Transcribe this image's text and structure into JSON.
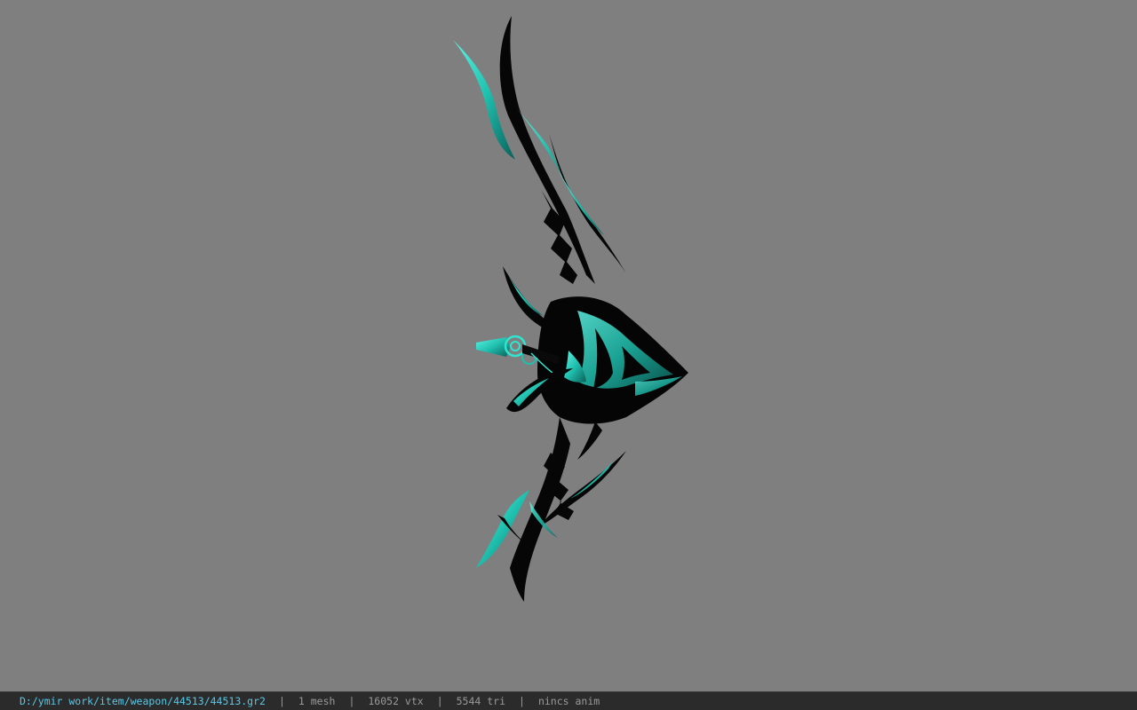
{
  "viewer": {
    "background_color": "#7f7f7f",
    "model": {
      "icon": "bow-weapon-model",
      "primary_color": "#0a0a0a",
      "accent_color": "#2ee6d0"
    }
  },
  "status": {
    "path": "D:/ymir work/item/weapon/44513/44513.gr2",
    "separator": "|",
    "mesh": "1 mesh",
    "vtx": "16052 vtx",
    "tri": "5544 tri",
    "anim": "nincs anim"
  }
}
